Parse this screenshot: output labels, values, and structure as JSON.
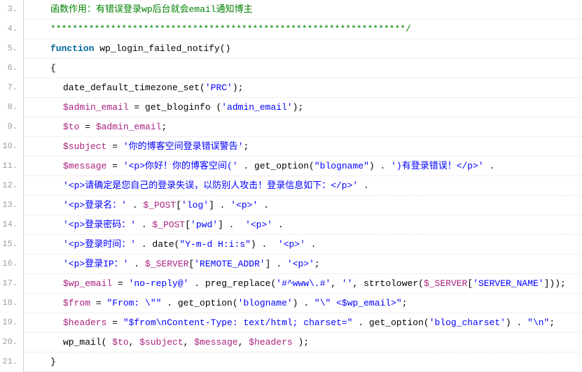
{
  "lines": [
    {
      "n": "3.",
      "indent": 1,
      "segs": [
        [
          "comment",
          "函数作用：有错误登录wp后台就会email通知博主"
        ]
      ]
    },
    {
      "n": "4.",
      "indent": 1,
      "segs": [
        [
          "comment",
          "*****************************************************************/"
        ]
      ]
    },
    {
      "n": "5.",
      "indent": 1,
      "segs": [
        [
          "keyword",
          "function"
        ],
        [
          "plain",
          " wp_login_failed_notify()"
        ]
      ]
    },
    {
      "n": "6.",
      "indent": 1,
      "segs": [
        [
          "plain",
          "{"
        ]
      ]
    },
    {
      "n": "7.",
      "indent": 2,
      "segs": [
        [
          "plain",
          "date_default_timezone_set("
        ],
        [
          "string",
          "'PRC'"
        ],
        [
          "plain",
          ");"
        ]
      ]
    },
    {
      "n": "8.",
      "indent": 2,
      "segs": [
        [
          "var",
          "$admin_email"
        ],
        [
          "plain",
          " = get_bloginfo ("
        ],
        [
          "string",
          "'admin_email'"
        ],
        [
          "plain",
          ");"
        ]
      ]
    },
    {
      "n": "9.",
      "indent": 2,
      "segs": [
        [
          "var",
          "$to"
        ],
        [
          "plain",
          " = "
        ],
        [
          "var",
          "$admin_email"
        ],
        [
          "plain",
          ";"
        ]
      ]
    },
    {
      "n": "10.",
      "indent": 2,
      "segs": [
        [
          "var",
          "$subject"
        ],
        [
          "plain",
          " = "
        ],
        [
          "string",
          "'你的博客空间登录错误警告'"
        ],
        [
          "plain",
          ";"
        ]
      ]
    },
    {
      "n": "11.",
      "indent": 2,
      "segs": [
        [
          "var",
          "$message"
        ],
        [
          "plain",
          " = "
        ],
        [
          "string",
          "'<p>你好！你的博客空间('"
        ],
        [
          "plain",
          " . get_option("
        ],
        [
          "string",
          "\"blogname\""
        ],
        [
          "plain",
          ") . "
        ],
        [
          "string",
          "')有登录错误！</p>'"
        ],
        [
          "plain",
          " ."
        ]
      ]
    },
    {
      "n": "12.",
      "indent": 2,
      "segs": [
        [
          "string",
          "'<p>请确定是您自己的登录失误，以防别人攻击！登录信息如下：</p>'"
        ],
        [
          "plain",
          " ."
        ]
      ]
    },
    {
      "n": "13.",
      "indent": 2,
      "segs": [
        [
          "string",
          "'<p>登录名：'"
        ],
        [
          "plain",
          " . "
        ],
        [
          "var",
          "$_POST"
        ],
        [
          "plain",
          "["
        ],
        [
          "string",
          "'log'"
        ],
        [
          "plain",
          "] . "
        ],
        [
          "string",
          "'<p>'"
        ],
        [
          "plain",
          " ."
        ]
      ]
    },
    {
      "n": "14.",
      "indent": 2,
      "segs": [
        [
          "string",
          "'<p>登录密码：'"
        ],
        [
          "plain",
          " . "
        ],
        [
          "var",
          "$_POST"
        ],
        [
          "plain",
          "["
        ],
        [
          "string",
          "'pwd'"
        ],
        [
          "plain",
          "] .  "
        ],
        [
          "string",
          "'<p>'"
        ],
        [
          "plain",
          " ."
        ]
      ]
    },
    {
      "n": "15.",
      "indent": 2,
      "segs": [
        [
          "string",
          "'<p>登录时间：'"
        ],
        [
          "plain",
          " . "
        ],
        [
          "funcname",
          "date"
        ],
        [
          "plain",
          "("
        ],
        [
          "string",
          "\"Y-m-d H:i:s\""
        ],
        [
          "plain",
          ") .  "
        ],
        [
          "string",
          "'<p>'"
        ],
        [
          "plain",
          " ."
        ]
      ]
    },
    {
      "n": "16.",
      "indent": 2,
      "segs": [
        [
          "string",
          "'<p>登录IP：'"
        ],
        [
          "plain",
          " . "
        ],
        [
          "var",
          "$_SERVER"
        ],
        [
          "plain",
          "["
        ],
        [
          "string",
          "'REMOTE_ADDR'"
        ],
        [
          "plain",
          "] . "
        ],
        [
          "string",
          "'<p>'"
        ],
        [
          "plain",
          ";"
        ]
      ]
    },
    {
      "n": "17.",
      "indent": 2,
      "segs": [
        [
          "var",
          "$wp_email"
        ],
        [
          "plain",
          " = "
        ],
        [
          "string",
          "'no-reply@'"
        ],
        [
          "plain",
          " . preg_replace("
        ],
        [
          "string",
          "'#^www\\.#'"
        ],
        [
          "plain",
          ", "
        ],
        [
          "string",
          "''"
        ],
        [
          "plain",
          ", "
        ],
        [
          "funcname",
          "strtolower"
        ],
        [
          "plain",
          "("
        ],
        [
          "var",
          "$_SERVER"
        ],
        [
          "plain",
          "["
        ],
        [
          "string",
          "'SERVER_NAME'"
        ],
        [
          "plain",
          "]));"
        ]
      ]
    },
    {
      "n": "18.",
      "indent": 2,
      "segs": [
        [
          "var",
          "$from"
        ],
        [
          "plain",
          " = "
        ],
        [
          "string",
          "\"From: \\\"\""
        ],
        [
          "plain",
          " . get_option("
        ],
        [
          "string",
          "'blogname'"
        ],
        [
          "plain",
          ") . "
        ],
        [
          "string",
          "\"\\\" <$wp_email>\""
        ],
        [
          "plain",
          ";"
        ]
      ]
    },
    {
      "n": "19.",
      "indent": 2,
      "segs": [
        [
          "var",
          "$headers"
        ],
        [
          "plain",
          " = "
        ],
        [
          "string",
          "\"$from\\nContent-Type: text/html; charset=\""
        ],
        [
          "plain",
          " . get_option("
        ],
        [
          "string",
          "'blog_charset'"
        ],
        [
          "plain",
          ") . "
        ],
        [
          "string",
          "\"\\n\""
        ],
        [
          "plain",
          ";"
        ]
      ]
    },
    {
      "n": "20.",
      "indent": 2,
      "segs": [
        [
          "plain",
          "wp_mail( "
        ],
        [
          "var",
          "$to"
        ],
        [
          "plain",
          ", "
        ],
        [
          "var",
          "$subject"
        ],
        [
          "plain",
          ", "
        ],
        [
          "var",
          "$message"
        ],
        [
          "plain",
          ", "
        ],
        [
          "var",
          "$headers"
        ],
        [
          "plain",
          " );"
        ]
      ]
    },
    {
      "n": "21.",
      "indent": 1,
      "segs": [
        [
          "plain",
          "}"
        ]
      ]
    }
  ]
}
